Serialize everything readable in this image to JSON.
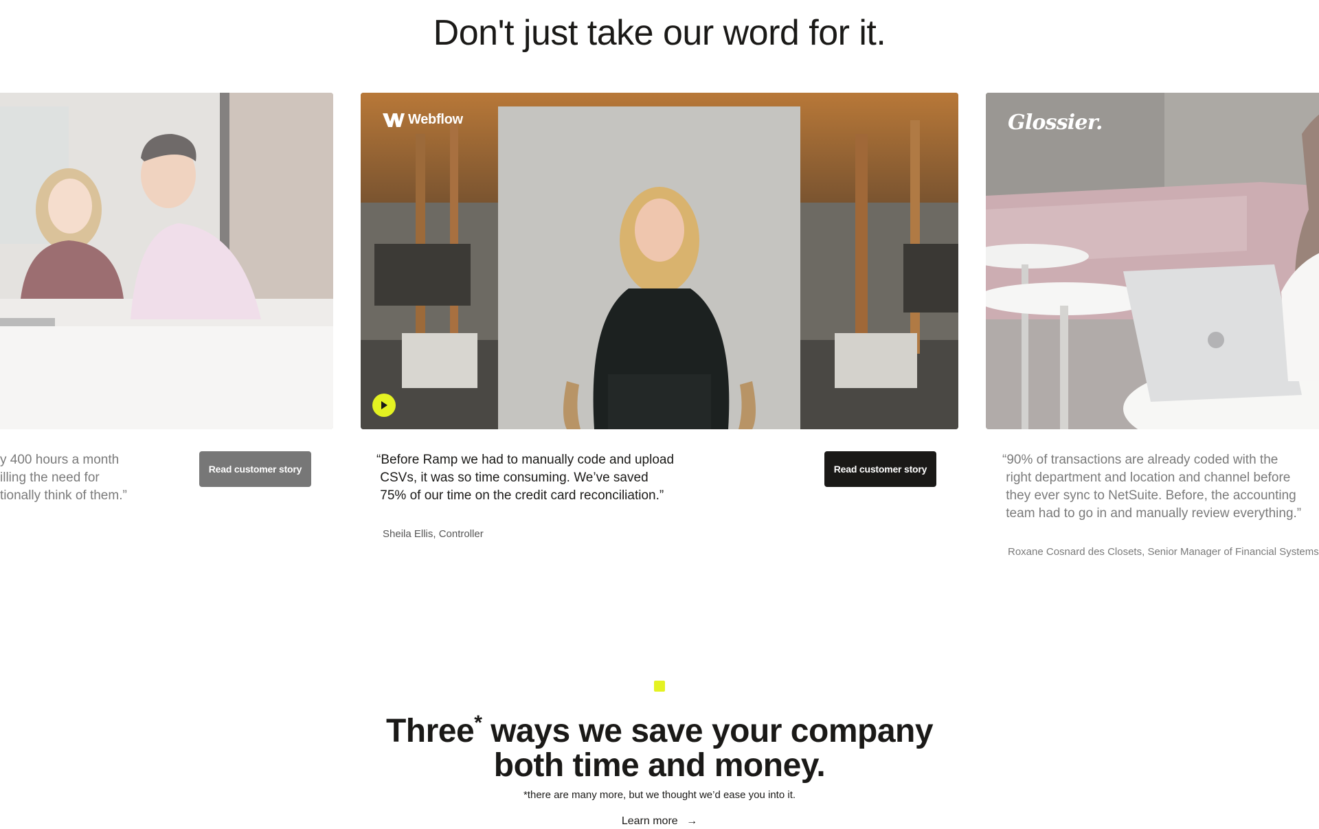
{
  "testimonials_section": {
    "heading": "Don't just take our word for it.",
    "cards": [
      {
        "quote": "y 400 hours a month\nilling the need for\ntionally think of them.”",
        "attribution": "",
        "button_label": "Read customer story"
      },
      {
        "logo_text": "Webflow",
        "logo_icon": "webflow-logo-icon",
        "quote": "“Before Ramp we had to manually code and upload\n CSVs, it was so time consuming. We’ve saved\n 75% of our time on the credit card reconciliation.”",
        "attribution": "Sheila Ellis, Controller",
        "button_label": "Read customer story",
        "play_icon": "play-icon"
      },
      {
        "logo_text": "Glossier.",
        "quote": "“90% of transactions are already coded with the\n right department and location and channel before\n they ever sync to NetSuite. Before, the accounting\n team had to go in and manually review everything.”",
        "attribution": "Roxane Cosnard des Closets, Senior Manager of Financial Systems"
      }
    ]
  },
  "savings_section": {
    "heading_part1": "Three",
    "heading_asterisk": "*",
    "heading_part2": " ways we save your company",
    "heading_line2": "both time and money.",
    "footnote": "*there are many more, but we thought we’d ease you into it.",
    "learn_more_label": "Learn more",
    "learn_more_icon": "arrow-right-icon",
    "accent_color": "#e4f222"
  }
}
